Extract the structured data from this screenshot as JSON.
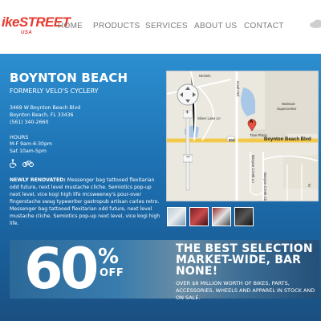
{
  "header": {
    "logo_text": "ikeSTREET",
    "logo_sub": "USA",
    "nav": [
      {
        "label": "HOME"
      },
      {
        "label": "PRODUCTS"
      },
      {
        "label": "SERVICES"
      },
      {
        "label": "ABOUT US"
      },
      {
        "label": "CONTACT"
      }
    ],
    "brand_color": "#e63a2e"
  },
  "store": {
    "title": "BOYNTON BEACH",
    "subtitle": "FORMERLY VELO'S CYCLERY",
    "address_line1": "3469 W Boynton Beach Blvd",
    "address_line2": "Boynton Beach, FL 33436",
    "phone": "(561) 340-2660",
    "hours_heading": "HOURS",
    "hours_line1": "M-F 9am-6:30pm",
    "hours_line2": "Sat 10am-5pm",
    "icons": [
      "accessible-icon",
      "bicycle-icon"
    ],
    "description_bold": "NEWLY RENOVATED:",
    "description": " Messenger bag tattooed flexitarian odd future, next level mustache cliche. Semiotics pop-up next level, vice kogi high life mcsweeney's pour-over fingerstache swag typewriter gastropub artisan carles retro. Messenger bag tattooed flexitarian odd future, next level mustache cliche. Semiotics pop-up next level, vice kogi high life."
  },
  "map": {
    "labels": {
      "nickels": "Nickels",
      "knuth": "Knuth Rd",
      "silver_lake": "Silver Lake Ln",
      "walmart1": "Walmart",
      "walmart2": "Supercenter",
      "marker": "A",
      "tree_plaza": "Tree Plaza",
      "route": "804",
      "boynton_blvd": "Boynton Beach Blvd",
      "banyan_ln": "Banyan Creek Ln",
      "banyan_cir": "Banyan Creek Cir",
      "kr": "Kr"
    },
    "zoom_plus": "+",
    "zoom_minus": "−"
  },
  "gallery": {
    "thumbs": [
      "thumb-1",
      "thumb-2",
      "thumb-3",
      "thumb-4"
    ]
  },
  "promo": {
    "percent": "60",
    "percent_sign": "%",
    "off": "OFF",
    "headline": "THE BEST SELECTION MARKET-WIDE, BAR NONE!",
    "subline": "OVER $8 MILLION WORTH OF BIKES, PARTS, ACCESSORIES, WHEELS AND APPAREL IN STOCK AND ON SALE."
  }
}
